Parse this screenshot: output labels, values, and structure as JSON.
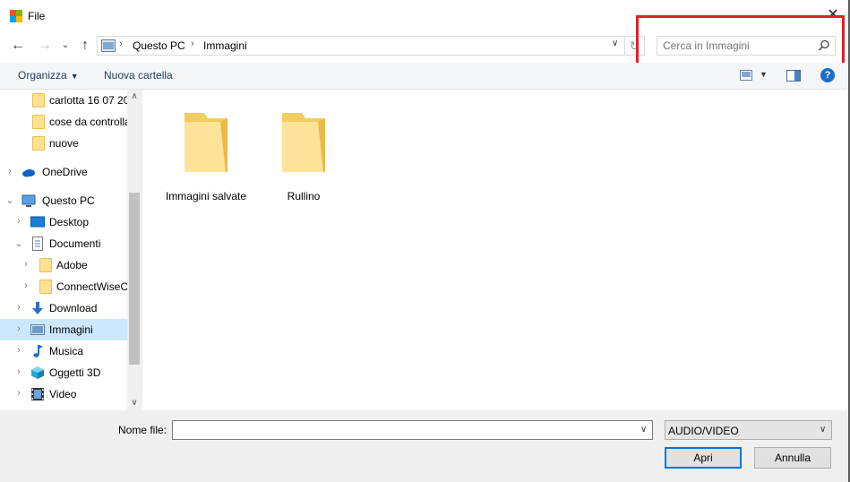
{
  "window": {
    "title": "File"
  },
  "address": {
    "crumbs": [
      "Questo PC",
      "Immagini"
    ]
  },
  "search": {
    "placeholder": "Cerca in Immagini"
  },
  "toolbar": {
    "organize_label": "Organizza",
    "new_folder_label": "Nuova cartella"
  },
  "navpane": {
    "items": [
      {
        "label": "carlotta 16 07 20"
      },
      {
        "label": "cose da controlla"
      },
      {
        "label": "nuove"
      },
      {
        "label": "OneDrive"
      },
      {
        "label": "Questo PC"
      },
      {
        "label": "Desktop"
      },
      {
        "label": "Documenti"
      },
      {
        "label": "Adobe"
      },
      {
        "label": "ConnectWiseC"
      },
      {
        "label": "Download"
      },
      {
        "label": "Immagini"
      },
      {
        "label": "Musica"
      },
      {
        "label": "Oggetti 3D"
      },
      {
        "label": "Video"
      }
    ],
    "selected": "Immagini"
  },
  "content": {
    "folders": [
      {
        "label": "Immagini salvate"
      },
      {
        "label": "Rullino"
      }
    ]
  },
  "bottom": {
    "filename_label": "Nome file:",
    "filename_value": "",
    "filter_value": "AUDIO/VIDEO",
    "open_label": "Apri",
    "cancel_label": "Annulla"
  },
  "colors": {
    "highlight": "#e2202a",
    "selection": "#cce8ff",
    "accent": "#0078d7"
  }
}
